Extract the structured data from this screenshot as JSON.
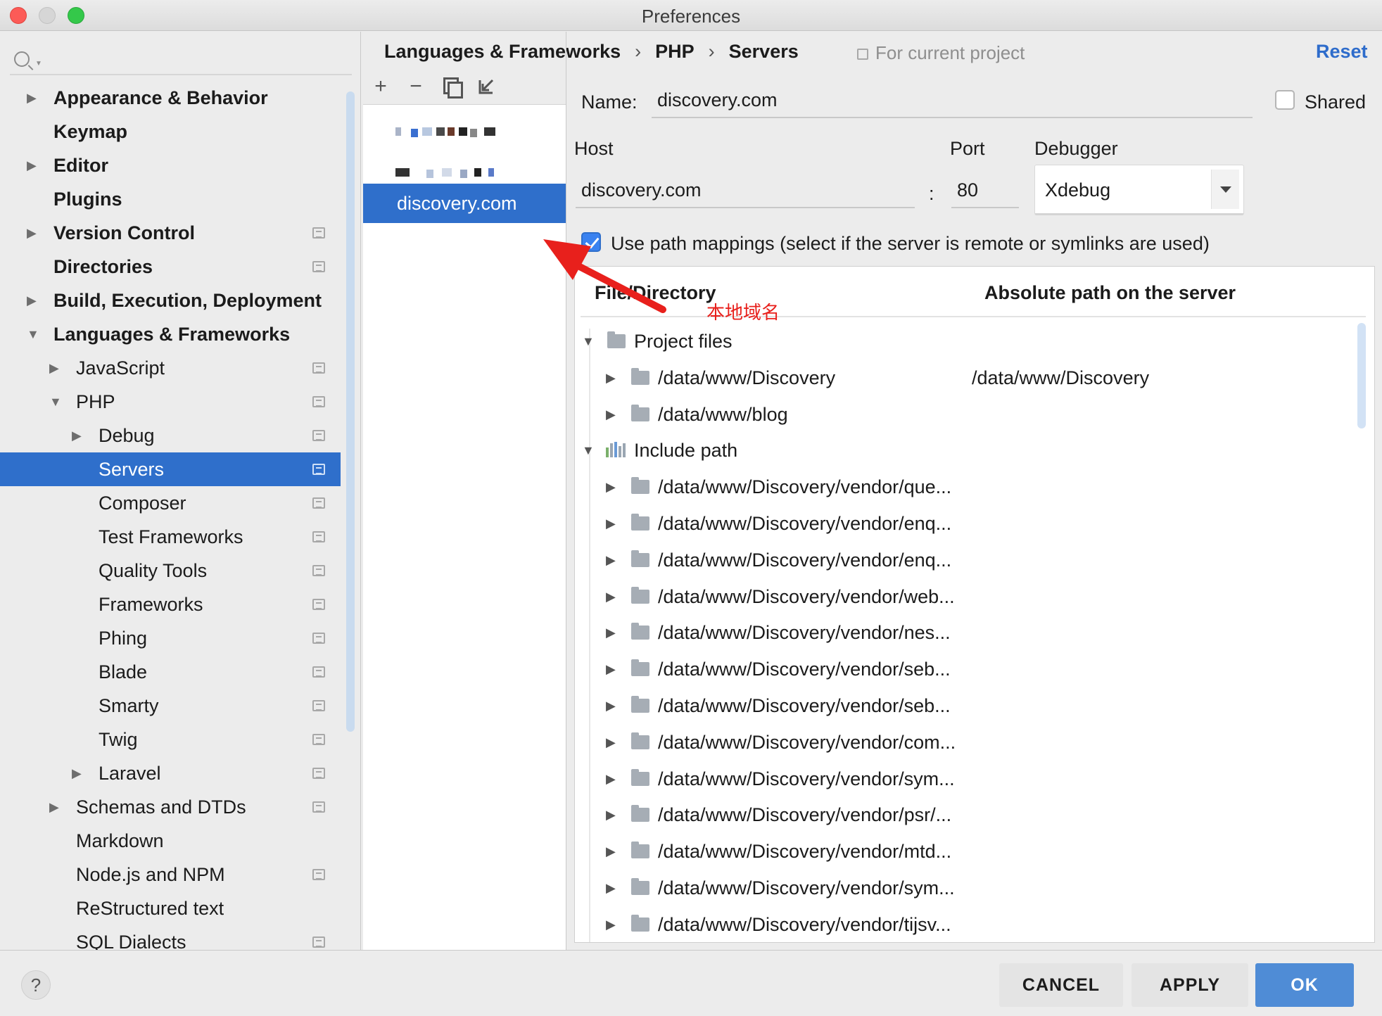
{
  "window": {
    "title": "Preferences"
  },
  "sidebar": {
    "items": [
      {
        "label": "Appearance & Behavior",
        "level": 0,
        "bold": true,
        "arrow": "collapsed",
        "project": false
      },
      {
        "label": "Keymap",
        "level": 0,
        "bold": true,
        "arrow": "none",
        "project": false
      },
      {
        "label": "Editor",
        "level": 0,
        "bold": true,
        "arrow": "collapsed",
        "project": false
      },
      {
        "label": "Plugins",
        "level": 0,
        "bold": true,
        "arrow": "none",
        "project": false
      },
      {
        "label": "Version Control",
        "level": 0,
        "bold": true,
        "arrow": "collapsed",
        "project": true
      },
      {
        "label": "Directories",
        "level": 0,
        "bold": true,
        "arrow": "none",
        "project": true
      },
      {
        "label": "Build, Execution, Deployment",
        "level": 0,
        "bold": true,
        "arrow": "collapsed",
        "project": false
      },
      {
        "label": "Languages & Frameworks",
        "level": 0,
        "bold": true,
        "arrow": "expanded",
        "project": false
      },
      {
        "label": "JavaScript",
        "level": 1,
        "bold": false,
        "arrow": "collapsed",
        "project": true
      },
      {
        "label": "PHP",
        "level": 1,
        "bold": false,
        "arrow": "expanded",
        "project": true
      },
      {
        "label": "Debug",
        "level": 2,
        "bold": false,
        "arrow": "collapsed",
        "project": true
      },
      {
        "label": "Servers",
        "level": 2,
        "bold": false,
        "arrow": "none",
        "project": true,
        "selected": true
      },
      {
        "label": "Composer",
        "level": 2,
        "bold": false,
        "arrow": "none",
        "project": true
      },
      {
        "label": "Test Frameworks",
        "level": 2,
        "bold": false,
        "arrow": "none",
        "project": true
      },
      {
        "label": "Quality Tools",
        "level": 2,
        "bold": false,
        "arrow": "none",
        "project": true
      },
      {
        "label": "Frameworks",
        "level": 2,
        "bold": false,
        "arrow": "none",
        "project": true
      },
      {
        "label": "Phing",
        "level": 2,
        "bold": false,
        "arrow": "none",
        "project": true
      },
      {
        "label": "Blade",
        "level": 2,
        "bold": false,
        "arrow": "none",
        "project": true
      },
      {
        "label": "Smarty",
        "level": 2,
        "bold": false,
        "arrow": "none",
        "project": true
      },
      {
        "label": "Twig",
        "level": 2,
        "bold": false,
        "arrow": "none",
        "project": true
      },
      {
        "label": "Laravel",
        "level": 2,
        "bold": false,
        "arrow": "collapsed",
        "project": true
      },
      {
        "label": "Schemas and DTDs",
        "level": 1,
        "bold": false,
        "arrow": "collapsed",
        "project": true
      },
      {
        "label": "Markdown",
        "level": 1,
        "bold": false,
        "arrow": "none",
        "project": false
      },
      {
        "label": "Node.js and NPM",
        "level": 1,
        "bold": false,
        "arrow": "none",
        "project": true
      },
      {
        "label": "ReStructured text",
        "level": 1,
        "bold": false,
        "arrow": "none",
        "project": false
      },
      {
        "label": "SQL Dialects",
        "level": 1,
        "bold": false,
        "arrow": "none",
        "project": true
      }
    ]
  },
  "breadcrumb": {
    "parts": [
      "Languages & Frameworks",
      "PHP",
      "Servers"
    ],
    "separator": "›"
  },
  "scope_label": "For current project",
  "reset_label": "Reset",
  "server_toolbar": {
    "add": "+",
    "remove": "−"
  },
  "servers": {
    "selected": "discovery.com"
  },
  "form": {
    "name_label": "Name:",
    "name_value": "discovery.com",
    "shared_label": "Shared",
    "host_label": "Host",
    "host_value": "discovery.com",
    "colon": ":",
    "port_label": "Port",
    "port_value": "80",
    "debugger_label": "Debugger",
    "debugger_value": "Xdebug",
    "path_mappings_label": "Use path mappings (select if the server is remote or symlinks are used)"
  },
  "mappings": {
    "col_file": "File/Directory",
    "col_remote": "Absolute path on the server",
    "rows": [
      {
        "kind": "group",
        "icon": "folder",
        "label": "Project files",
        "remote": ""
      },
      {
        "kind": "item",
        "label": "/data/www/Discovery",
        "remote": "/data/www/Discovery"
      },
      {
        "kind": "item",
        "label": "/data/www/blog",
        "remote": ""
      },
      {
        "kind": "group",
        "icon": "library",
        "label": "Include path",
        "remote": ""
      },
      {
        "kind": "item",
        "label": "/data/www/Discovery/vendor/que...",
        "remote": ""
      },
      {
        "kind": "item",
        "label": "/data/www/Discovery/vendor/enq...",
        "remote": ""
      },
      {
        "kind": "item",
        "label": "/data/www/Discovery/vendor/enq...",
        "remote": ""
      },
      {
        "kind": "item",
        "label": "/data/www/Discovery/vendor/web...",
        "remote": ""
      },
      {
        "kind": "item",
        "label": "/data/www/Discovery/vendor/nes...",
        "remote": ""
      },
      {
        "kind": "item",
        "label": "/data/www/Discovery/vendor/seb...",
        "remote": ""
      },
      {
        "kind": "item",
        "label": "/data/www/Discovery/vendor/seb...",
        "remote": ""
      },
      {
        "kind": "item",
        "label": "/data/www/Discovery/vendor/com...",
        "remote": ""
      },
      {
        "kind": "item",
        "label": "/data/www/Discovery/vendor/sym...",
        "remote": ""
      },
      {
        "kind": "item",
        "label": "/data/www/Discovery/vendor/psr/...",
        "remote": ""
      },
      {
        "kind": "item",
        "label": "/data/www/Discovery/vendor/mtd...",
        "remote": ""
      },
      {
        "kind": "item",
        "label": "/data/www/Discovery/vendor/sym...",
        "remote": ""
      },
      {
        "kind": "item",
        "label": "/data/www/Discovery/vendor/tijsv...",
        "remote": ""
      }
    ]
  },
  "annotation": {
    "text": "本地域名",
    "color": "#e8201c"
  },
  "footer": {
    "help": "?",
    "cancel": "CANCEL",
    "apply": "APPLY",
    "ok": "OK"
  },
  "colors": {
    "selection": "#2f6fcb",
    "link": "#2e6ccb",
    "ok_button": "#4f8cd6"
  }
}
